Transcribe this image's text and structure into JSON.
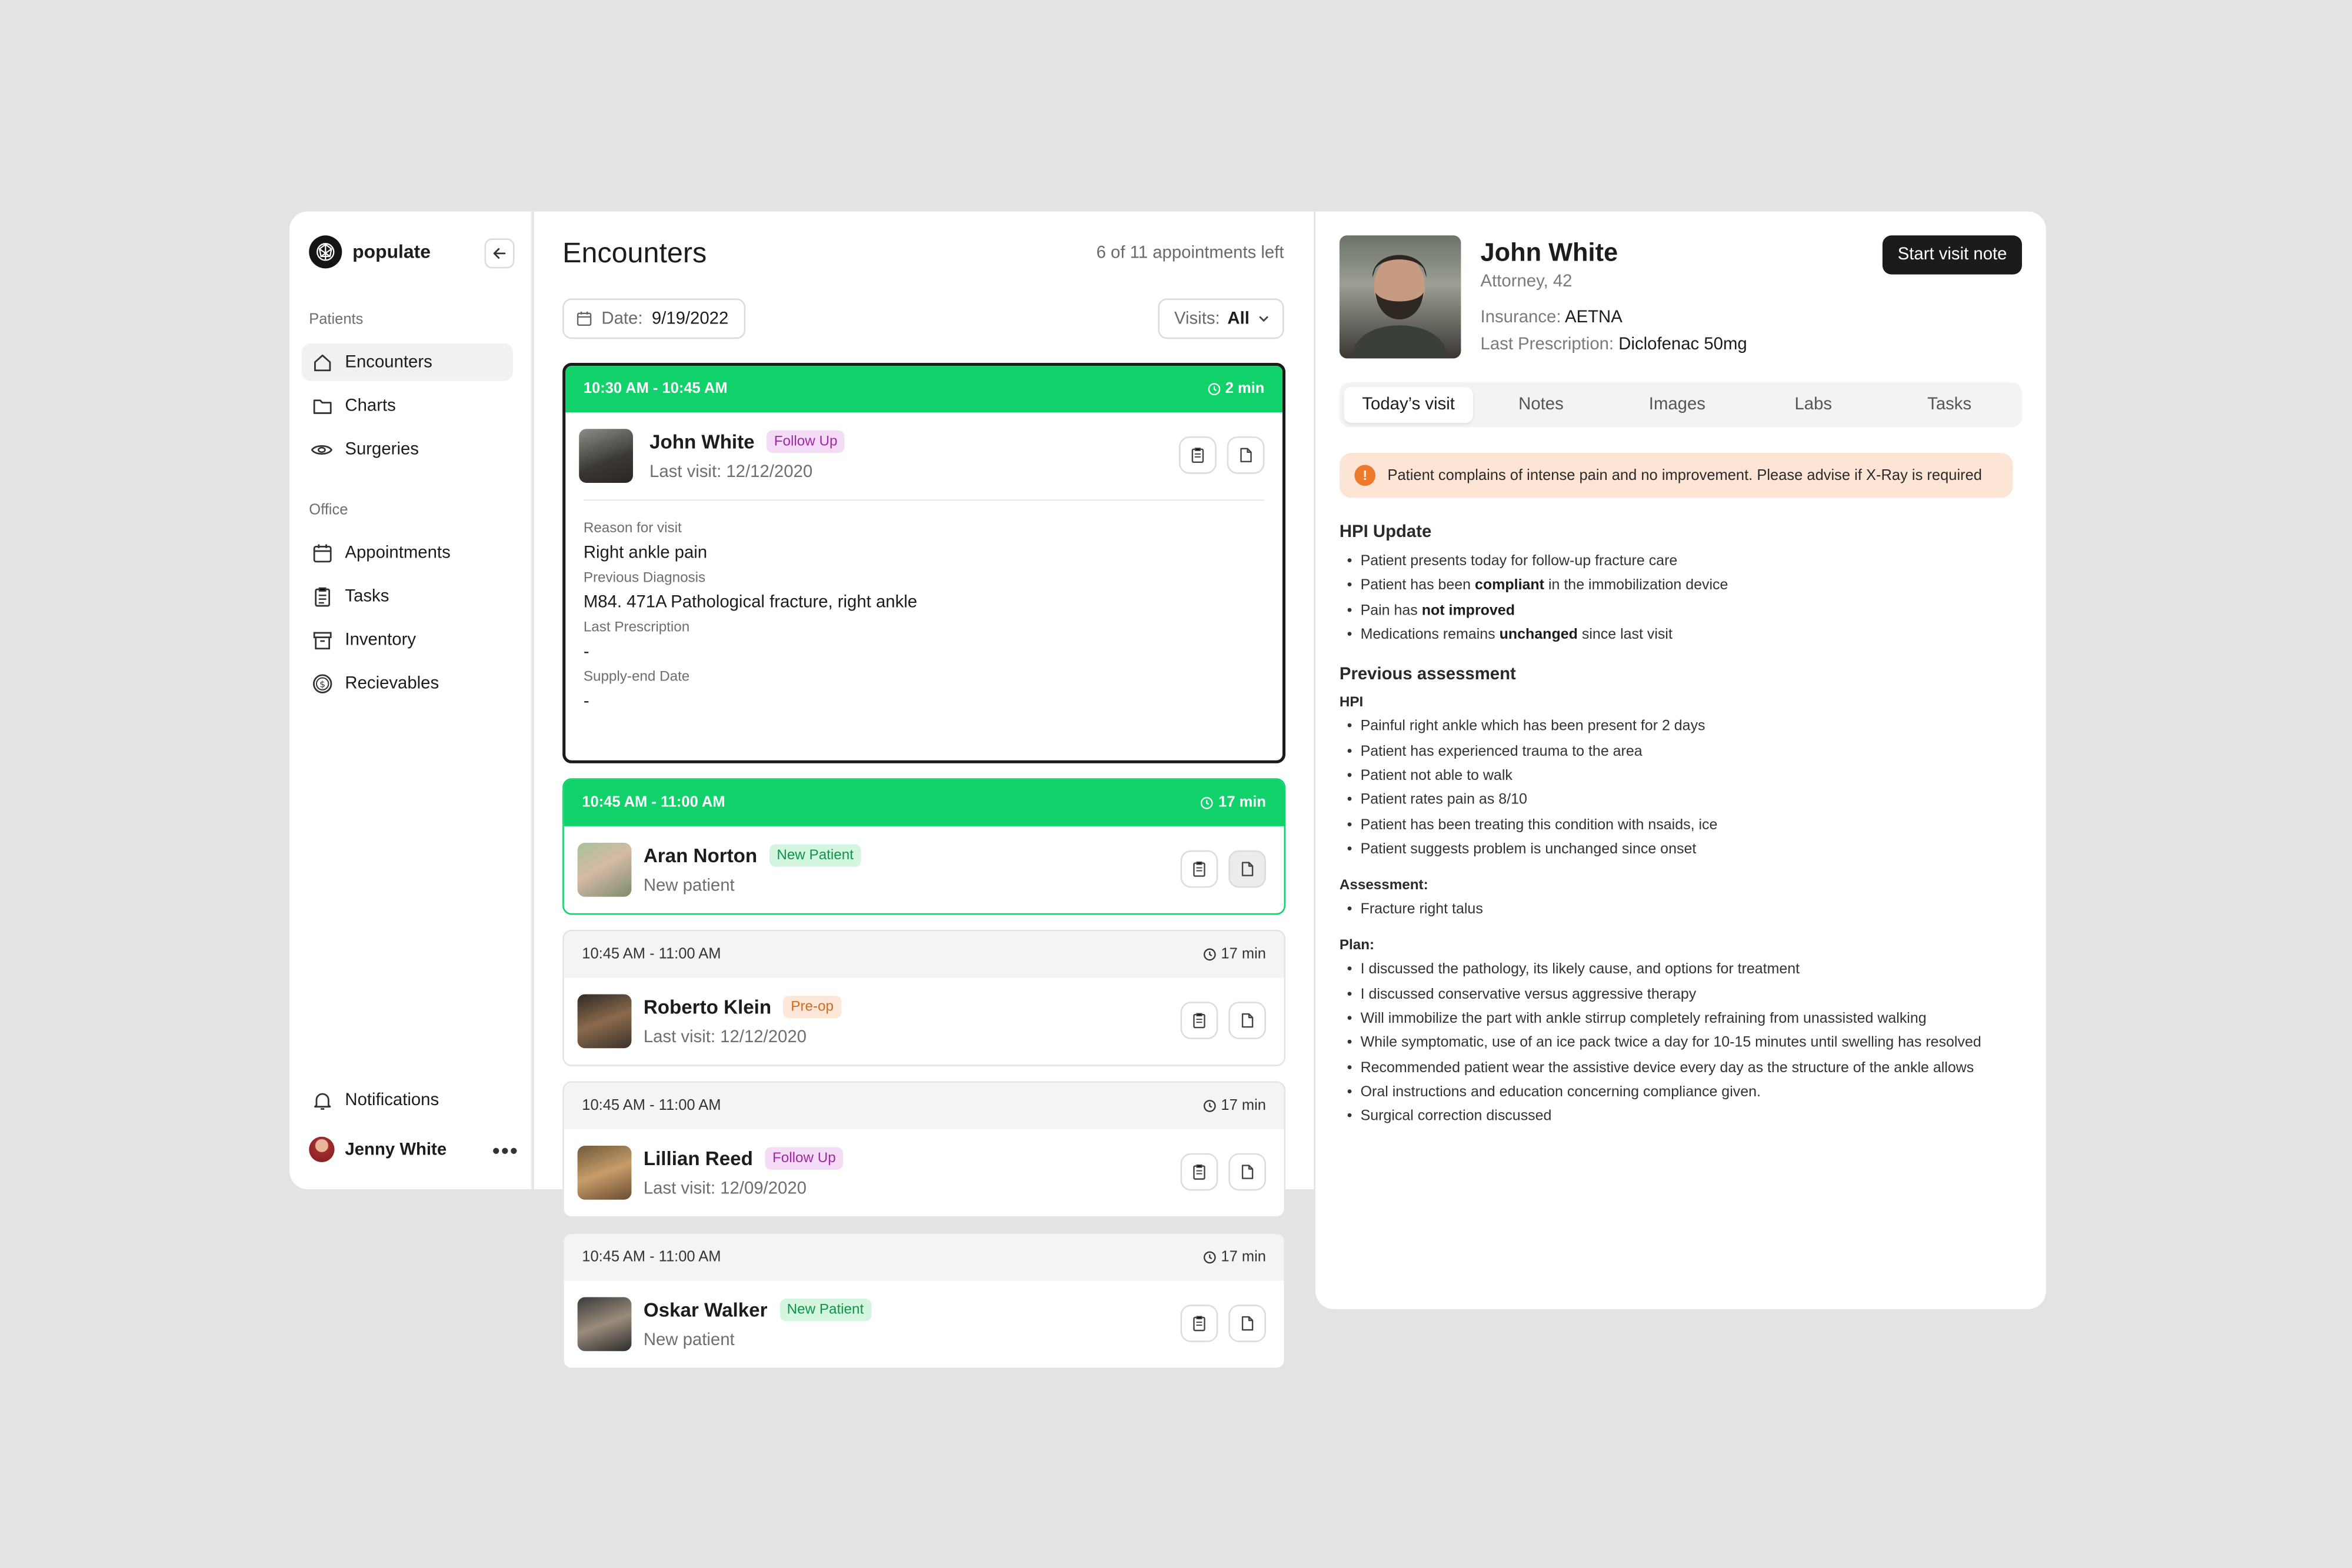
{
  "brand": {
    "name": "populate"
  },
  "sidebar": {
    "patients_label": "Patients",
    "office_label": "Office",
    "items": [
      {
        "label": "Encounters",
        "icon": "home-icon"
      },
      {
        "label": "Charts",
        "icon": "folder-icon"
      },
      {
        "label": "Surgeries",
        "icon": "eye-icon"
      },
      {
        "label": "Appointments",
        "icon": "calendar-icon"
      },
      {
        "label": "Tasks",
        "icon": "clipboard-icon"
      },
      {
        "label": "Inventory",
        "icon": "archive-icon"
      },
      {
        "label": "Recievables",
        "icon": "dollar-icon"
      }
    ],
    "notifications": "Notifications",
    "user": "Jenny White"
  },
  "encounters": {
    "title": "Encounters",
    "appointments_left": "6 of 11 appointments left",
    "date_label": "Date:",
    "date_value": "9/19/2022",
    "visits_label": "Visits:",
    "visits_value": "All",
    "cards": [
      {
        "time": "10:30 AM - 10:45 AM",
        "duration": "2 min",
        "status": "active",
        "name": "John White",
        "badge": "Follow Up",
        "sub": "Last visit: 12/12/2020",
        "details": [
          {
            "label": "Reason for visit",
            "value": "Right ankle pain"
          },
          {
            "label": "Previous Diagnosis",
            "value": "M84. 471A Pathological fracture, right ankle"
          },
          {
            "label": "Last Prescription",
            "value": "-"
          },
          {
            "label": "Supply-end Date",
            "value": "-"
          }
        ]
      },
      {
        "time": "10:45 AM - 11:00 AM",
        "duration": "17 min",
        "status": "current",
        "name": "Aran Norton",
        "badge": "New Patient",
        "sub": "New patient"
      },
      {
        "time": "10:45 AM - 11:00 AM",
        "duration": "17 min",
        "status": "upcoming",
        "name": "Roberto Klein",
        "badge": "Pre-op",
        "sub": "Last visit: 12/12/2020"
      },
      {
        "time": "10:45 AM - 11:00 AM",
        "duration": "17 min",
        "status": "upcoming",
        "name": "Lillian Reed",
        "badge": "Follow Up",
        "sub": "Last visit: 12/09/2020"
      },
      {
        "time": "10:45 AM - 11:00 AM",
        "duration": "17 min",
        "status": "upcoming",
        "name": "Oskar Walker",
        "badge": "New Patient",
        "sub": "New patient"
      }
    ]
  },
  "patient": {
    "name": "John White",
    "role": "Attorney, 42",
    "insurance_label": "Insurance:",
    "insurance": "AETNA",
    "rx_label": "Last Prescription:",
    "rx": "Diclofenac 50mg",
    "start_button": "Start visit note",
    "tabs": [
      "Today’s visit",
      "Notes",
      "Images",
      "Labs",
      "Tasks"
    ],
    "alert": "Patient complains of intense pain and no improvement. Please advise if X-Ray is required",
    "hpi_update_title": "HPI Update",
    "hpi_update": [
      {
        "pre": "Patient presents today for follow-up fracture care",
        "bold": "",
        "post": ""
      },
      {
        "pre": "Patient has been ",
        "bold": "compliant",
        "post": " in the immobilization device"
      },
      {
        "pre": "Pain has ",
        "bold": "not improved",
        "post": ""
      },
      {
        "pre": "Medications remains ",
        "bold": "unchanged",
        "post": " since last visit"
      }
    ],
    "prev_title": "Previous assessment",
    "hpi_label": "HPI",
    "hpi": [
      "Painful right ankle which has been present for 2 days",
      "Patient has experienced trauma to the area",
      "Patient not able to walk",
      "Patient rates pain as 8/10",
      "Patient has been treating this condition with nsaids, ice",
      "Patient suggests problem is unchanged since onset"
    ],
    "assessment_label": "Assessment:",
    "assessment": [
      "Fracture right talus"
    ],
    "plan_label": "Plan:",
    "plan": [
      "I discussed the pathology, its likely cause, and options for treatment",
      "I discussed conservative versus aggressive therapy",
      "Will immobilize the part with ankle stirrup completely refraining from unassisted walking",
      "While symptomatic, use of an ice pack twice a day for 10-15 minutes until swelling has resolved",
      "Recommended patient wear the assistive device every day as the structure of the ankle allows",
      "Oral instructions and education concerning compliance given.",
      "Surgical correction discussed"
    ]
  },
  "colors": {
    "accent_green": "#11d26a",
    "alert_bg": "#fde5d6",
    "alert_icon": "#ef7a2c",
    "follow_badge": "#a226a8",
    "new_badge": "#10924a",
    "preop_badge": "#d46a1f"
  }
}
